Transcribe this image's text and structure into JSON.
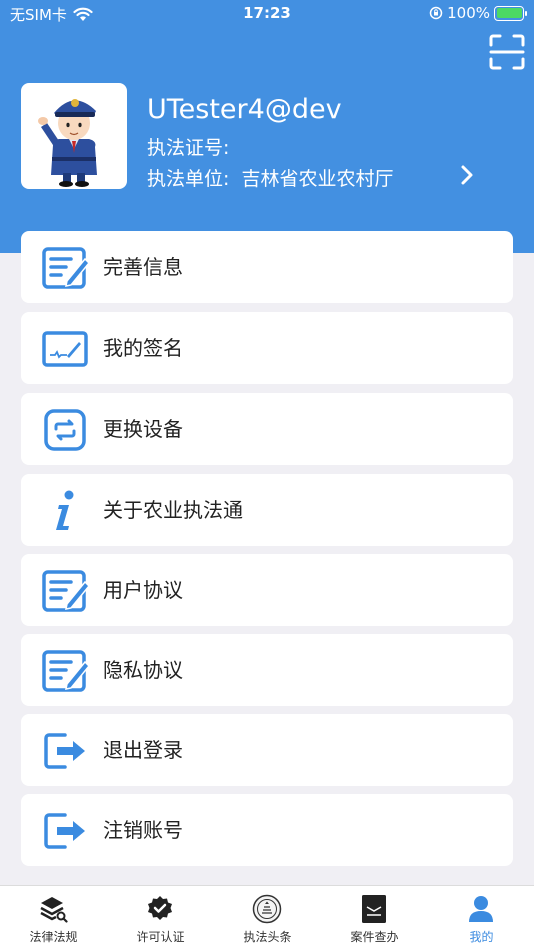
{
  "status_bar": {
    "carrier": "无SIM卡",
    "time": "17:23",
    "battery": "100%"
  },
  "profile": {
    "username": "UTester4@dev",
    "cert_label": "执法证号:",
    "unit_label": "执法单位:",
    "unit_value": "吉林省农业农村厅"
  },
  "menu": [
    {
      "label": "完善信息",
      "icon": "edit-form-icon"
    },
    {
      "label": "我的签名",
      "icon": "signature-tablet-icon"
    },
    {
      "label": "更换设备",
      "icon": "swap-device-icon"
    },
    {
      "label": "关于农业执法通",
      "icon": "info-icon"
    },
    {
      "label": "用户协议",
      "icon": "document-edit-icon"
    },
    {
      "label": "隐私协议",
      "icon": "document-edit-icon"
    },
    {
      "label": "退出登录",
      "icon": "logout-icon"
    },
    {
      "label": "注销账号",
      "icon": "logout-icon"
    }
  ],
  "tabs": [
    {
      "label": "法律法规",
      "icon": "law-books-icon"
    },
    {
      "label": "许可认证",
      "icon": "badge-check-icon"
    },
    {
      "label": "执法头条",
      "icon": "emblem-icon"
    },
    {
      "label": "案件查办",
      "icon": "case-file-icon"
    },
    {
      "label": "我的",
      "icon": "person-icon"
    }
  ],
  "colors": {
    "header_blue": "#4390e1",
    "accent_blue": "#3b8be0",
    "page_bg": "#f0eff4",
    "battery_green": "#4cd964"
  }
}
